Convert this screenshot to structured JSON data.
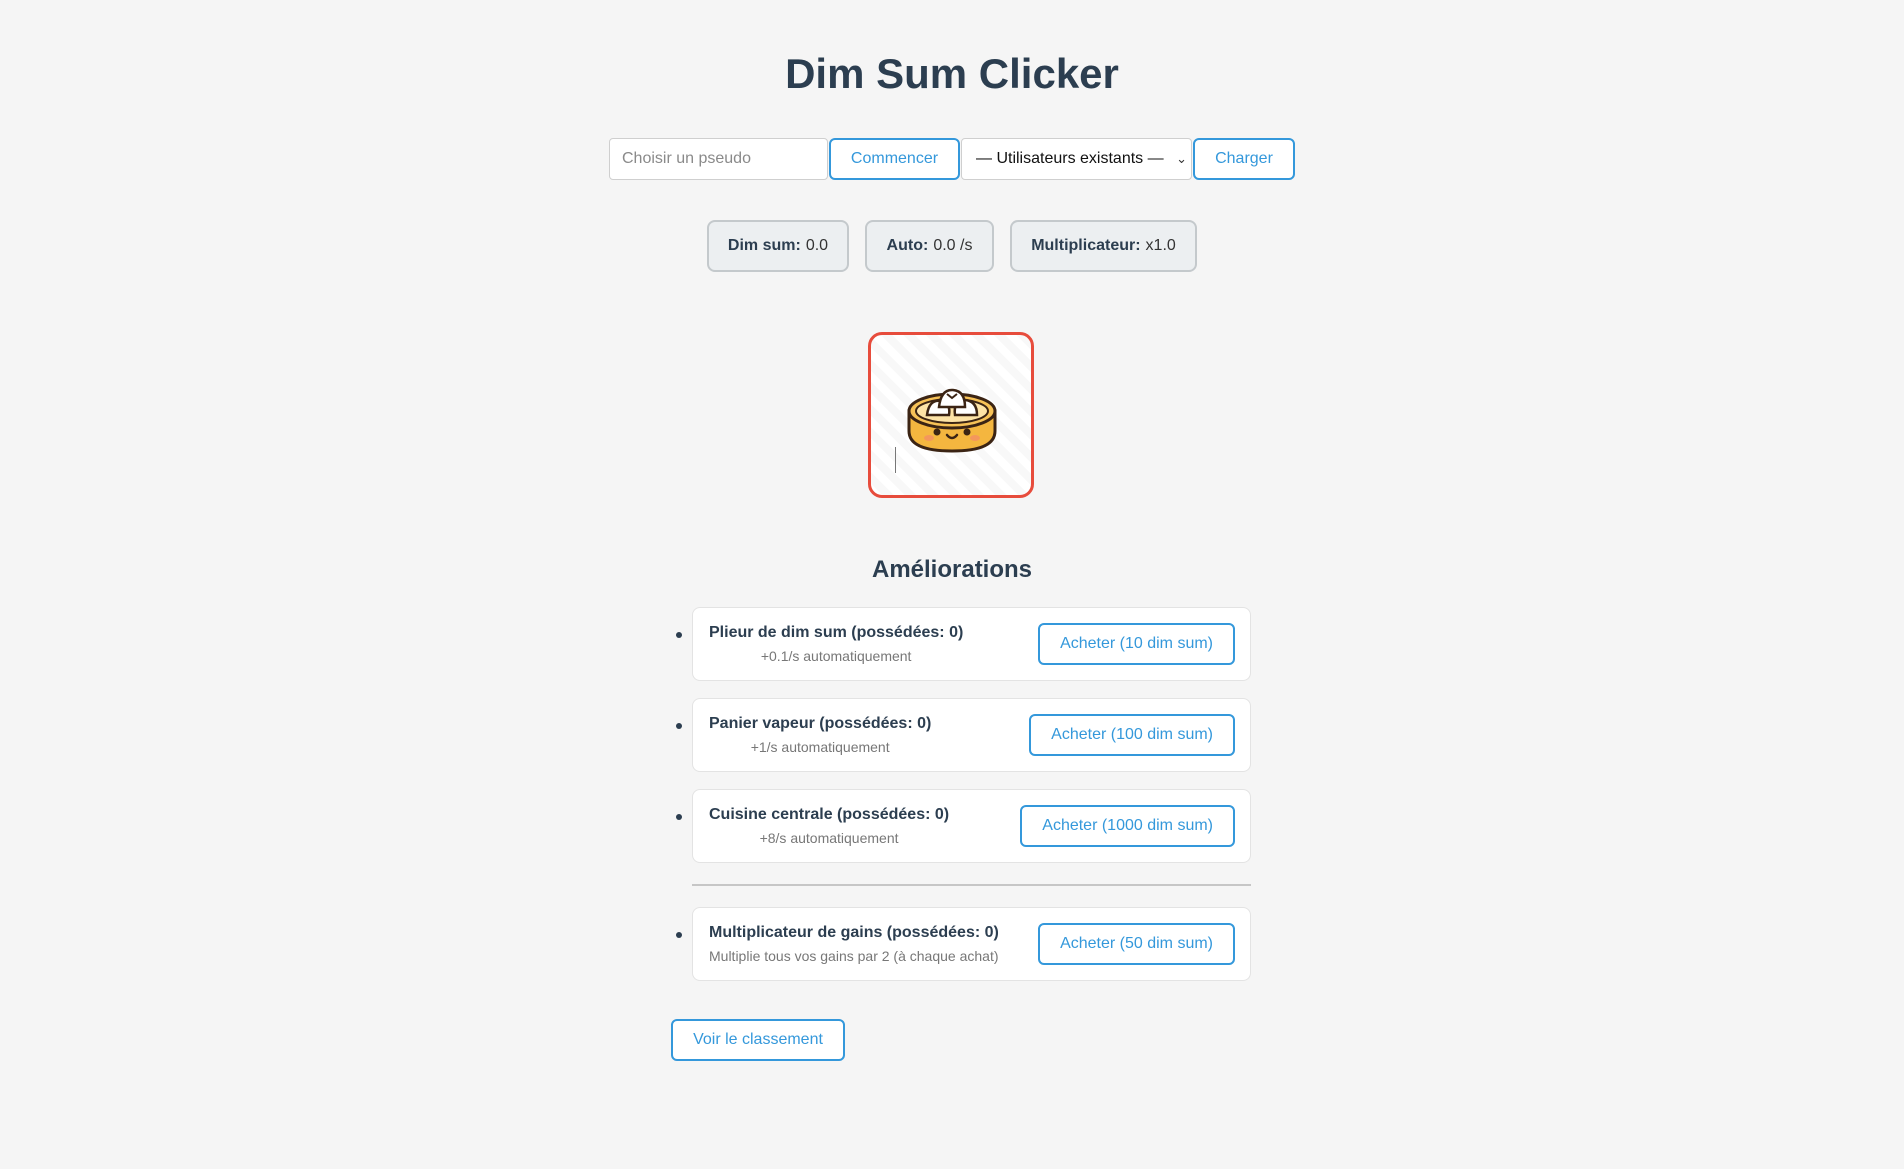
{
  "app": {
    "title": "Dim Sum Clicker"
  },
  "login": {
    "pseudo_placeholder": "Choisir un pseudo",
    "pseudo_value": "",
    "start_label": "Commencer",
    "users_select_value": "— Utilisateurs existants —",
    "load_label": "Charger"
  },
  "stats": {
    "dimsum_label": "Dim sum:",
    "dimsum_value": "0.0",
    "auto_label": "Auto:",
    "auto_value": "0.0 /s",
    "mult_label": "Multiplicateur:",
    "mult_value": "x1.0"
  },
  "clicker": {
    "icon": "dim-sum-steamer-icon"
  },
  "upgrades": {
    "heading": "Améliorations",
    "items": [
      {
        "name": "Plieur de dim sum (possédées: 0)",
        "desc": "+0.1/s automatiquement",
        "buy_label": "Acheter (10 dim sum)"
      },
      {
        "name": "Panier vapeur (possédées: 0)",
        "desc": "+1/s automatiquement",
        "buy_label": "Acheter (100 dim sum)"
      },
      {
        "name": "Cuisine centrale (possédées: 0)",
        "desc": "+8/s automatiquement",
        "buy_label": "Acheter (1000 dim sum)"
      }
    ],
    "multiplier": {
      "name": "Multiplicateur de gains (possédées: 0)",
      "desc": "Multiplie tous vos gains par 2 (à chaque achat)",
      "buy_label": "Acheter (50 dim sum)"
    }
  },
  "leaderboard": {
    "button_label": "Voir le classement"
  },
  "colors": {
    "accent": "#3498db",
    "clicker_border": "#e74c3c",
    "heading": "#2c3e50",
    "background": "#f5f5f5"
  }
}
